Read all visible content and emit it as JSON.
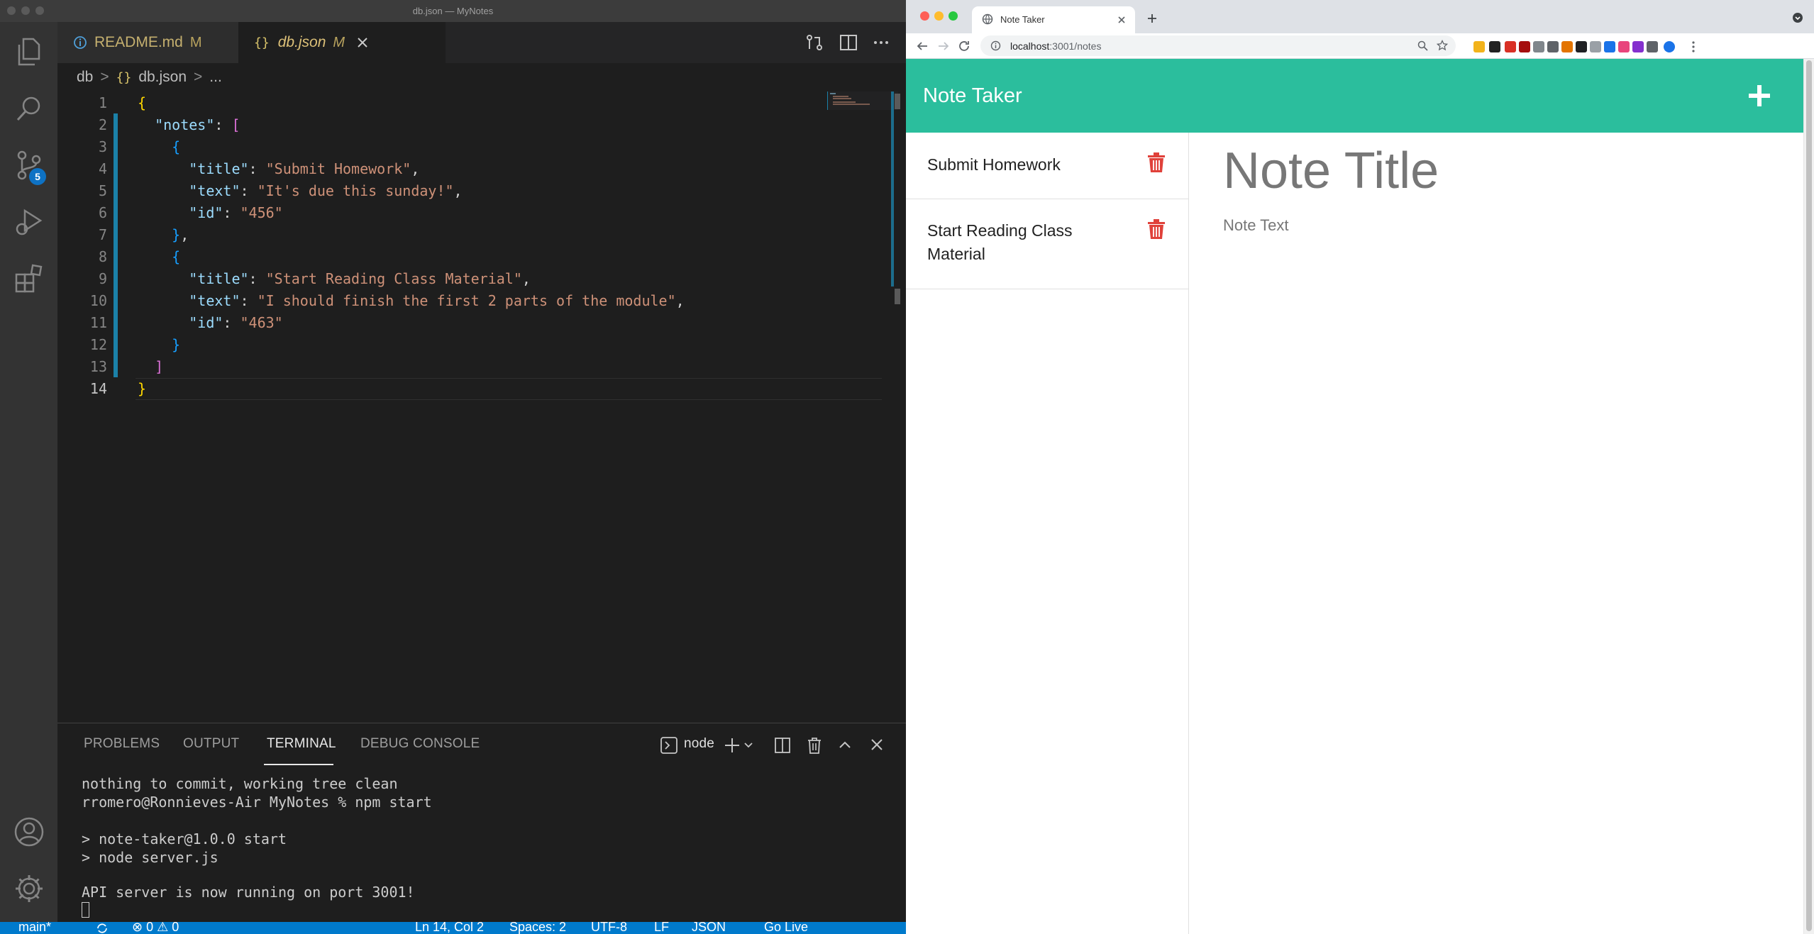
{
  "vscode": {
    "window_title": "db.json — MyNotes",
    "source_control_badge": "5",
    "tabs": [
      {
        "label": "README.md",
        "flag": "M",
        "icon": "info-icon"
      },
      {
        "label": "db.json",
        "flag": "M",
        "icon": "json-braces-icon"
      }
    ],
    "breadcrumb": {
      "folder": "db",
      "braces": "{}",
      "file": "db.json",
      "more": "..."
    },
    "line_numbers": [
      "1",
      "2",
      "3",
      "4",
      "5",
      "6",
      "7",
      "8",
      "9",
      "10",
      "11",
      "12",
      "13",
      "14"
    ],
    "code": {
      "l2_key": "\"notes\"",
      "l4_key": "\"title\"",
      "l4_val": "\"Submit Homework\"",
      "l5_key": "\"text\"",
      "l5_val": "\"It's due this sunday!\"",
      "l6_key": "\"id\"",
      "l6_val": "\"456\"",
      "l9_key": "\"title\"",
      "l9_val": "\"Start Reading Class Material\"",
      "l10_key": "\"text\"",
      "l10_val": "\"I should finish the first 2 parts of the module\"",
      "l11_key": "\"id\"",
      "l11_val": "\"463\""
    },
    "panel": {
      "tabs": [
        "PROBLEMS",
        "OUTPUT",
        "TERMINAL",
        "DEBUG CONSOLE"
      ],
      "terminal_name": "node",
      "terminal_lines": [
        "nothing to commit, working tree clean",
        "rromero@Ronnieves-Air MyNotes % npm start",
        "",
        "> note-taker@1.0.0 start",
        "> node server.js",
        "",
        "API server is now running on port 3001!"
      ]
    },
    "statusbar": {
      "branch": "main*",
      "problems": "⊗ 0 ⚠ 0",
      "position": "Ln 14, Col 2",
      "spaces": "Spaces: 2",
      "encoding": "UTF-8",
      "eol": "LF",
      "language": "JSON",
      "golive": "Go Live"
    },
    "colors": {
      "accent": "#007acc",
      "string": "#ce9178",
      "key": "#9cdcfe"
    }
  },
  "browser": {
    "tab_title": "Note Taker",
    "url_host": "localhost",
    "url_path": ":3001/notes",
    "app": {
      "title": "Note Taker",
      "notes": [
        {
          "title": "Submit Homework"
        },
        {
          "title": "Start Reading Class Material"
        }
      ],
      "note_title_placeholder": "Note Title",
      "note_text_placeholder": "Note Text"
    },
    "colors": {
      "navbar": "#2bbe9d",
      "trash": "#e0413a"
    }
  }
}
